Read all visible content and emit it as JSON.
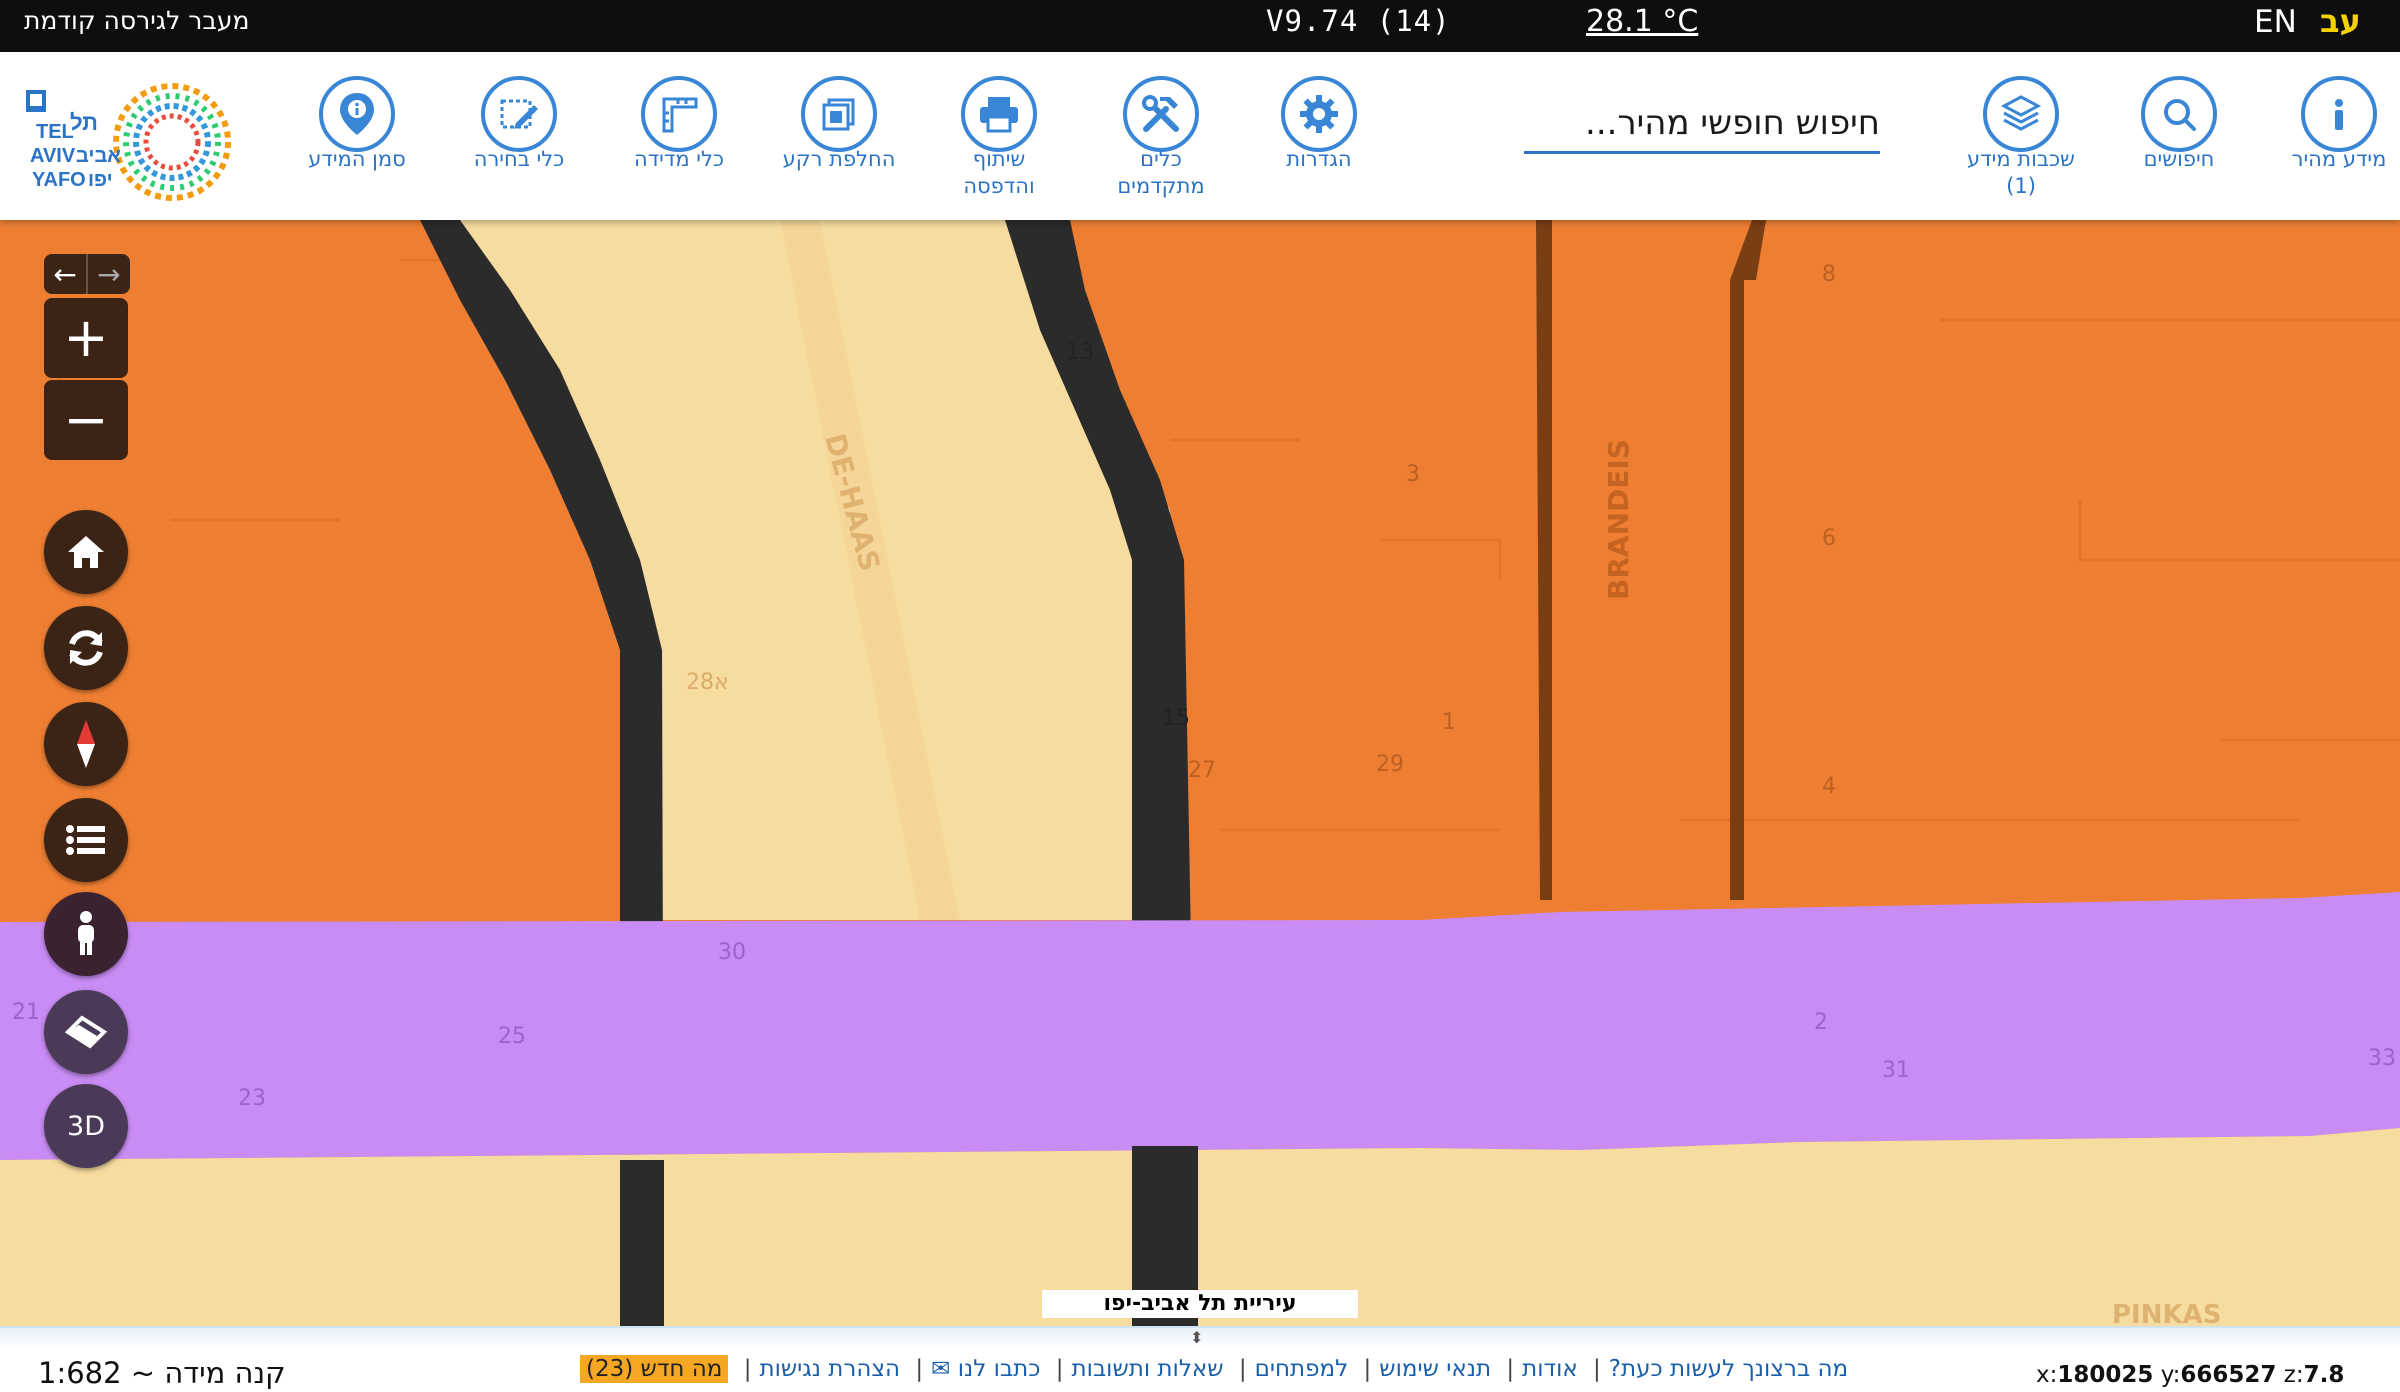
{
  "topbar": {
    "prev_version_link": "מעבר לגירסה קודמת",
    "version": "V9.74 (14)",
    "weather": "28.1 °C",
    "lang_en": "EN",
    "lang_he": "עב"
  },
  "toolbar": {
    "tools": [
      {
        "id": "info-marker",
        "label": "סמן המידע",
        "icon": "map-pin-info-icon"
      },
      {
        "id": "selection",
        "label": "כלי בחירה",
        "icon": "select-edit-icon"
      },
      {
        "id": "measure",
        "label": "כלי מדידה",
        "icon": "ruler-icon"
      },
      {
        "id": "basemap",
        "label": "החלפת רקע",
        "icon": "layers-swap-icon"
      },
      {
        "id": "share-print",
        "label": "שיתוף\nוהדפסה",
        "label_line1": "שיתוף",
        "label_line2": "והדפסה",
        "icon": "printer-icon"
      },
      {
        "id": "advanced-tools",
        "label_line1": "כלים",
        "label_line2": "מתקדמים",
        "icon": "tools-icon"
      },
      {
        "id": "settings",
        "label": "הגדרות",
        "icon": "gear-icon"
      },
      {
        "id": "info-layers",
        "label_line1": "שכבות מידע",
        "label_line2": "(1)",
        "icon": "layers-icon"
      },
      {
        "id": "searches",
        "label": "חיפושים",
        "icon": "search-icon"
      },
      {
        "id": "quick-info",
        "label": "מידע מהיר",
        "icon": "info-icon"
      }
    ],
    "search_placeholder": "חיפוש חופשי מהיר..."
  },
  "logo": {
    "text_en_1": "TEL",
    "text_en_2": "AVIV",
    "text_en_3": "YAFO",
    "text_he_1": "תל",
    "text_he_2": "אביב",
    "text_he_3": "יפו"
  },
  "map": {
    "streets": [
      "DE-HAAS",
      "BRANDEIS",
      "PINKAS"
    ],
    "house_numbers": [
      "8",
      "13",
      "3",
      "6",
      "1",
      "15",
      "27",
      "29",
      "4",
      "28א",
      "30",
      "25",
      "23",
      "21",
      "2",
      "31",
      "33"
    ],
    "colors": {
      "orange": "#ee7f32",
      "purple": "#c88cf4",
      "cream": "#f7dca0",
      "black_line": "#2b2b2b"
    },
    "controls": {
      "zoom_in": "+",
      "zoom_out": "−",
      "three_d": "3D"
    },
    "attribution": "עיריית תל אביב-יפו"
  },
  "bottom": {
    "scale": "קנה מידה ~ 1:682",
    "links": [
      "מה ברצונך לעשות כעת?",
      "אודות",
      "תנאי שימוש",
      "למפתחים",
      "שאלות ותשובות",
      "כתבו לנו ✉",
      "הצהרת נגישות"
    ],
    "whats_new": "מה חדש (23)",
    "coords": {
      "x_label": "x:",
      "x": "180025",
      "y_label": "y:",
      "y": "666527",
      "z_label": "z:",
      "z": "7.8"
    }
  }
}
